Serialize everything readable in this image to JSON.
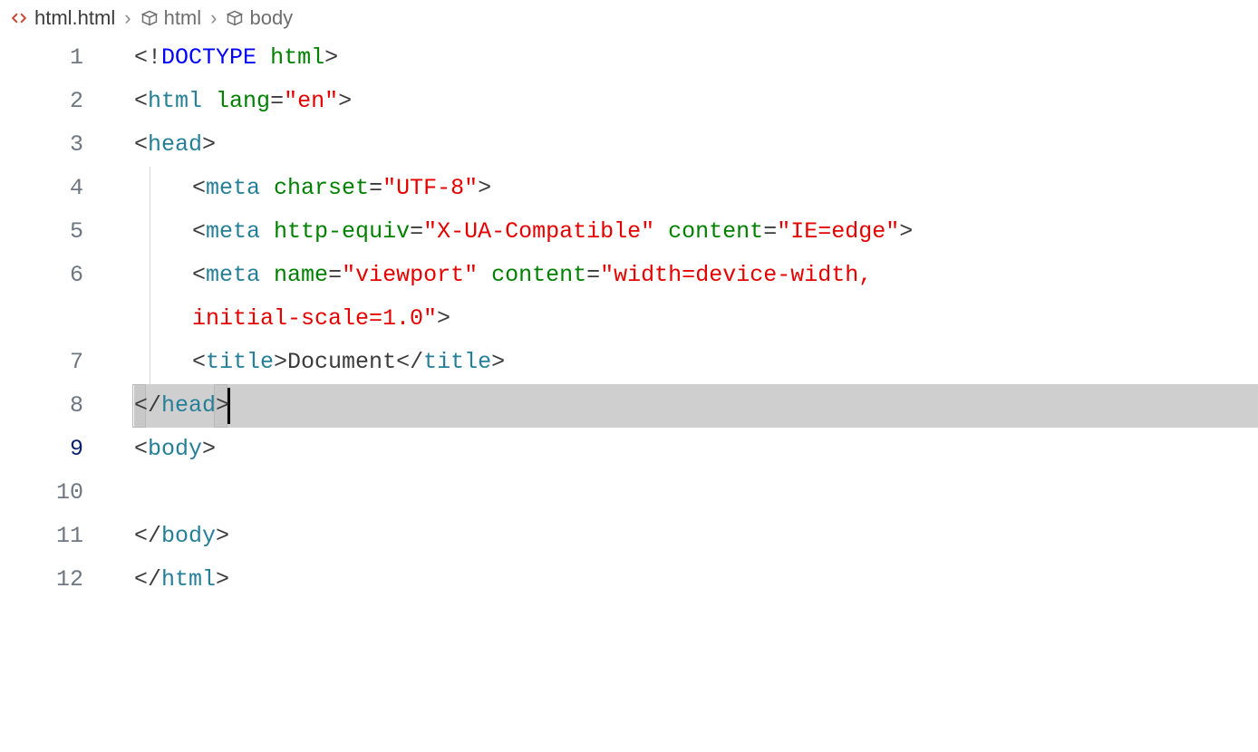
{
  "breadcrumbs": [
    {
      "label": "html.html",
      "icon": "file-code",
      "active": true
    },
    {
      "label": "html",
      "icon": "symbol",
      "active": false
    },
    {
      "label": "body",
      "icon": "symbol",
      "active": false
    }
  ],
  "currentLine": 9,
  "lines": {
    "1": {
      "number": "1",
      "tokens": [
        {
          "t": "<",
          "c": "p"
        },
        {
          "t": "!",
          "c": "bang"
        },
        {
          "t": "DOCTYPE",
          "c": "doctype-kw"
        },
        {
          "t": " ",
          "c": "p"
        },
        {
          "t": "html",
          "c": "attr"
        },
        {
          "t": ">",
          "c": "p"
        }
      ]
    },
    "2": {
      "number": "2",
      "tokens": [
        {
          "t": "<",
          "c": "p"
        },
        {
          "t": "html",
          "c": "tagname"
        },
        {
          "t": " ",
          "c": "p"
        },
        {
          "t": "lang",
          "c": "attr"
        },
        {
          "t": "=",
          "c": "p"
        },
        {
          "t": "\"en\"",
          "c": "string"
        },
        {
          "t": ">",
          "c": "p"
        }
      ]
    },
    "3": {
      "number": "3",
      "tokens": [
        {
          "t": "<",
          "c": "p"
        },
        {
          "t": "head",
          "c": "tagname"
        },
        {
          "t": ">",
          "c": "p"
        }
      ]
    },
    "4": {
      "number": "4",
      "indent": 1,
      "guide": true,
      "tokens": [
        {
          "t": "<",
          "c": "p"
        },
        {
          "t": "meta",
          "c": "tagname"
        },
        {
          "t": " ",
          "c": "p"
        },
        {
          "t": "charset",
          "c": "attr"
        },
        {
          "t": "=",
          "c": "p"
        },
        {
          "t": "\"UTF-8\"",
          "c": "string"
        },
        {
          "t": ">",
          "c": "p"
        }
      ]
    },
    "5": {
      "number": "5",
      "indent": 1,
      "guide": true,
      "tokens": [
        {
          "t": "<",
          "c": "p"
        },
        {
          "t": "meta",
          "c": "tagname"
        },
        {
          "t": " ",
          "c": "p"
        },
        {
          "t": "http-equiv",
          "c": "attr"
        },
        {
          "t": "=",
          "c": "p"
        },
        {
          "t": "\"X-UA-Compatible\"",
          "c": "string"
        },
        {
          "t": " ",
          "c": "p"
        },
        {
          "t": "content",
          "c": "attr"
        },
        {
          "t": "=",
          "c": "p"
        },
        {
          "t": "\"IE=edge\"",
          "c": "string"
        },
        {
          "t": ">",
          "c": "p"
        }
      ]
    },
    "6": {
      "number": "6",
      "indent": 1,
      "guide": true,
      "tokens": [
        {
          "t": "<",
          "c": "p"
        },
        {
          "t": "meta",
          "c": "tagname"
        },
        {
          "t": " ",
          "c": "p"
        },
        {
          "t": "name",
          "c": "attr"
        },
        {
          "t": "=",
          "c": "p"
        },
        {
          "t": "\"viewport\"",
          "c": "string"
        },
        {
          "t": " ",
          "c": "p"
        },
        {
          "t": "content",
          "c": "attr"
        },
        {
          "t": "=",
          "c": "p"
        },
        {
          "t": "\"width=device-width, ",
          "c": "string"
        }
      ]
    },
    "6b": {
      "wrap": true,
      "indent": 1,
      "guide": true,
      "tokens": [
        {
          "t": "initial-scale=1.0\"",
          "c": "string"
        },
        {
          "t": ">",
          "c": "p"
        }
      ]
    },
    "7": {
      "number": "7",
      "indent": 1,
      "guide": true,
      "tokens": [
        {
          "t": "<",
          "c": "p"
        },
        {
          "t": "title",
          "c": "tagname"
        },
        {
          "t": ">",
          "c": "p"
        },
        {
          "t": "Document",
          "c": "text"
        },
        {
          "t": "</",
          "c": "p"
        },
        {
          "t": "title",
          "c": "tagname"
        },
        {
          "t": ">",
          "c": "p"
        }
      ]
    },
    "8": {
      "number": "8",
      "tokens": [
        {
          "t": "</",
          "c": "p"
        },
        {
          "t": "head",
          "c": "tagname"
        },
        {
          "t": ">",
          "c": "p"
        }
      ]
    },
    "9": {
      "number": "9",
      "current": true,
      "tokens": [
        {
          "t": "<",
          "c": "p"
        },
        {
          "t": "body",
          "c": "tagname"
        },
        {
          "t": ">",
          "c": "p"
        }
      ]
    },
    "10": {
      "number": "10",
      "tokens": [
        {
          "t": "    ",
          "c": "p"
        }
      ]
    },
    "11": {
      "number": "11",
      "tokens": [
        {
          "t": "</",
          "c": "p"
        },
        {
          "t": "body",
          "c": "tagname"
        },
        {
          "t": ">",
          "c": "p"
        }
      ]
    },
    "12": {
      "number": "12",
      "tokens": [
        {
          "t": "</",
          "c": "p"
        },
        {
          "t": "html",
          "c": "tagname"
        },
        {
          "t": ">",
          "c": "p"
        }
      ]
    }
  },
  "lineOrder": [
    "1",
    "2",
    "3",
    "4",
    "5",
    "6",
    "6b",
    "7",
    "8",
    "9",
    "10",
    "11",
    "12"
  ]
}
